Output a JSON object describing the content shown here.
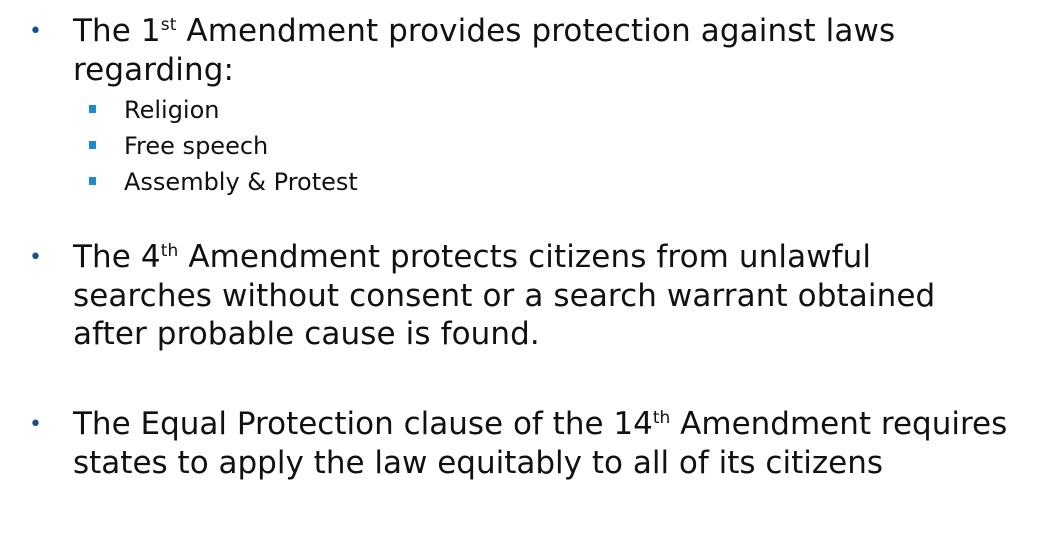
{
  "bullets": [
    {
      "prefix": "The 1",
      "sup": "st",
      "suffix": " Amendment provides protection against laws regarding:",
      "sub_items": [
        "Religion",
        "Free speech",
        "Assembly & Protest"
      ]
    },
    {
      "prefix": "The 4",
      "sup": "th",
      "suffix": " Amendment protects citizens from unlawful searches without consent or a search warrant obtained after probable cause is found."
    },
    {
      "prefix": "The Equal Protection clause of the 14",
      "sup": "th",
      "suffix": " Amendment requires states to apply the law equitably to all of its citizens"
    }
  ],
  "colors": {
    "main_bullet": "#1a4f8b",
    "sub_bullet": "#1e8ad0",
    "text": "#111111"
  }
}
